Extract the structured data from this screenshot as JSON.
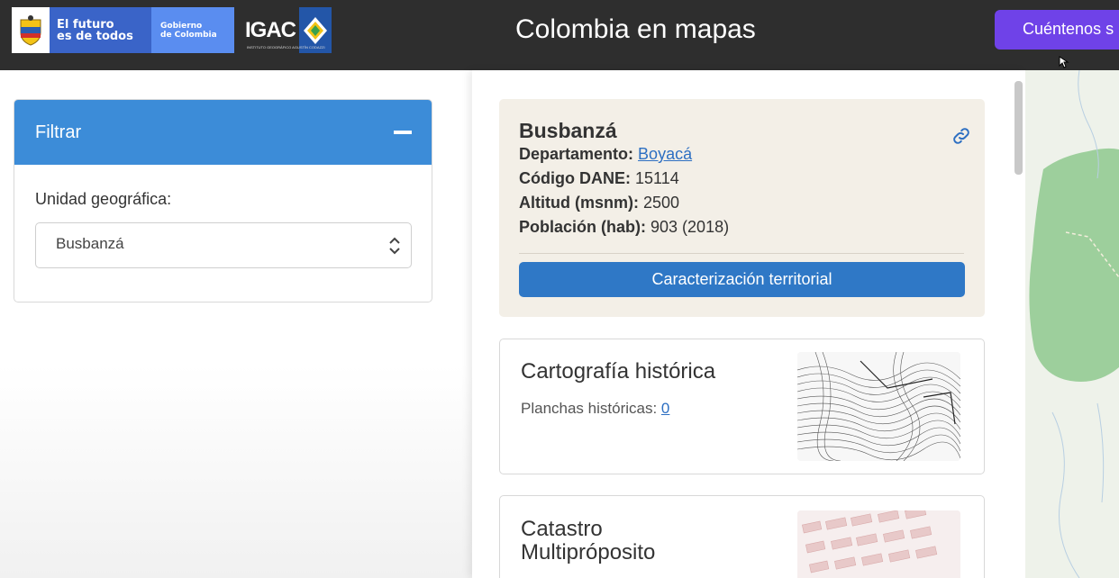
{
  "header": {
    "gov_text_line1": "El futuro",
    "gov_text_line2": "es de todos",
    "gov_right_line1": "Gobierno",
    "gov_right_line2": "de Colombia",
    "igac_text": "IGAC",
    "igac_sub": "INSTITUTO GEOGRÁFICO AGUSTÍN CODAZZI",
    "title": "Colombia en mapas",
    "feedback_button": "Cuéntenos s"
  },
  "filter": {
    "title": "Filtrar",
    "unit_label": "Unidad geográfica:",
    "unit_value": "Busbanzá"
  },
  "info": {
    "name": "Busbanzá",
    "dept_label": "Departamento:",
    "dept_value": "Boyacá",
    "dane_label": "Código DANE:",
    "dane_value": "15114",
    "alt_label": "Altitud (msnm):",
    "alt_value": "2500",
    "pop_label": "Población (hab):",
    "pop_value": "903 (2018)",
    "button": "Caracterización territorial"
  },
  "cartografia": {
    "title": "Cartografía histórica",
    "planchas_label": "Planchas históricas:",
    "planchas_value": "0"
  },
  "catastro": {
    "title_line1": "Catastro",
    "title_line2": "Multipróposito"
  },
  "colors": {
    "header_bg": "#2e2e2e",
    "filter_head": "#3c8cd8",
    "primary_button": "#2f78c6",
    "feedback_button": "#6f42e8",
    "info_card_bg": "#f3efe7",
    "map_green": "#8ec98e"
  }
}
